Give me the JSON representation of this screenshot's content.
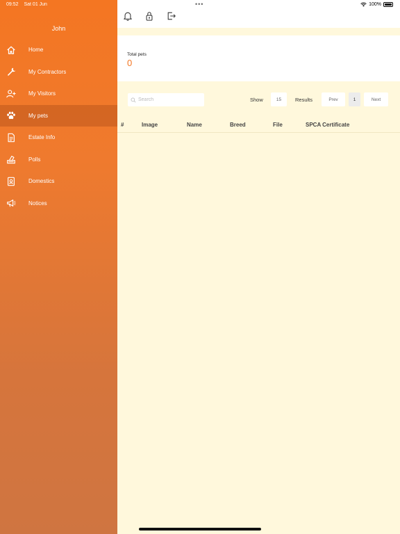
{
  "status_bar": {
    "time": "09:52",
    "date": "Sat 01 Jun",
    "battery": "100%"
  },
  "sidebar": {
    "user_name": "John",
    "items": [
      {
        "label": "Home",
        "icon": "home-icon"
      },
      {
        "label": "My Contractors",
        "icon": "wrench-icon"
      },
      {
        "label": "My Visitors",
        "icon": "add-person-icon"
      },
      {
        "label": "My pets",
        "icon": "paw-icon",
        "active": true
      },
      {
        "label": "Estate Info",
        "icon": "document-icon"
      },
      {
        "label": "Polls",
        "icon": "ballot-box-icon"
      },
      {
        "label": "Domestics",
        "icon": "id-card-icon"
      },
      {
        "label": "Notices",
        "icon": "megaphone-icon"
      }
    ]
  },
  "toolbar": {
    "icons": [
      "bell-icon",
      "lock-icon",
      "logout-icon"
    ]
  },
  "stats": {
    "total_pets_label": "Total pets",
    "total_pets_value": "0"
  },
  "controls": {
    "search_placeholder": "Search",
    "show_label": "Show",
    "page_size": "15",
    "results_label": "Results",
    "prev_label": "Prev",
    "current_page": "1",
    "next_label": "Next"
  },
  "table": {
    "columns": [
      "#",
      "Image",
      "Name",
      "Breed",
      "File",
      "SPCA Certificate"
    ],
    "rows": []
  },
  "colors": {
    "accent": "#f47622",
    "content_bg": "#fff8dc"
  }
}
